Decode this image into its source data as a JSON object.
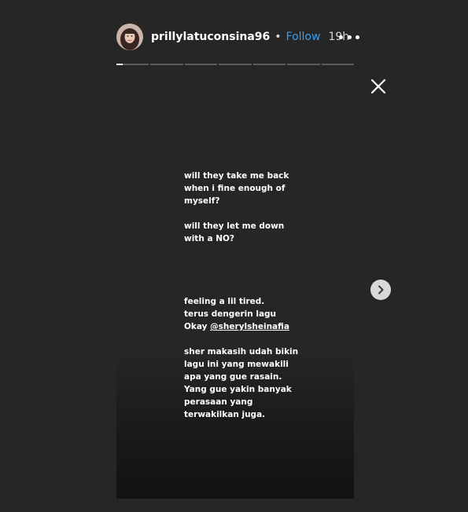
{
  "header": {
    "username": "prillylatuconsina96",
    "separator": "•",
    "follow_label": "Follow",
    "time": "19h",
    "more_icon": "more-horizontal-icon"
  },
  "progress": {
    "segment_count": 7,
    "current_index": 0,
    "current_progress": 0.2
  },
  "close_icon": "close-icon",
  "story": {
    "paragraph1": "will they take me back\nwhen i fine enough of\nmyself?",
    "paragraph2": "will they let me down\nwith a NO?",
    "paragraph3_prefix": "feeling a lil tired.\nterus dengerin lagu\nOkay ",
    "mention": "@sherylsheinafia",
    "paragraph4": "sher makasih udah bikin\nlagu ini yang mewakili\napa yang gue rasain.\nYang gue yakin banyak\nperasaan yang\nterwakilkan juga."
  },
  "next_icon": "chevron-right-icon",
  "colors": {
    "background": "#262626",
    "follow": "#3b9cf1",
    "progress_track": "#5b5b5b",
    "progress_fill": "#ffffff"
  }
}
